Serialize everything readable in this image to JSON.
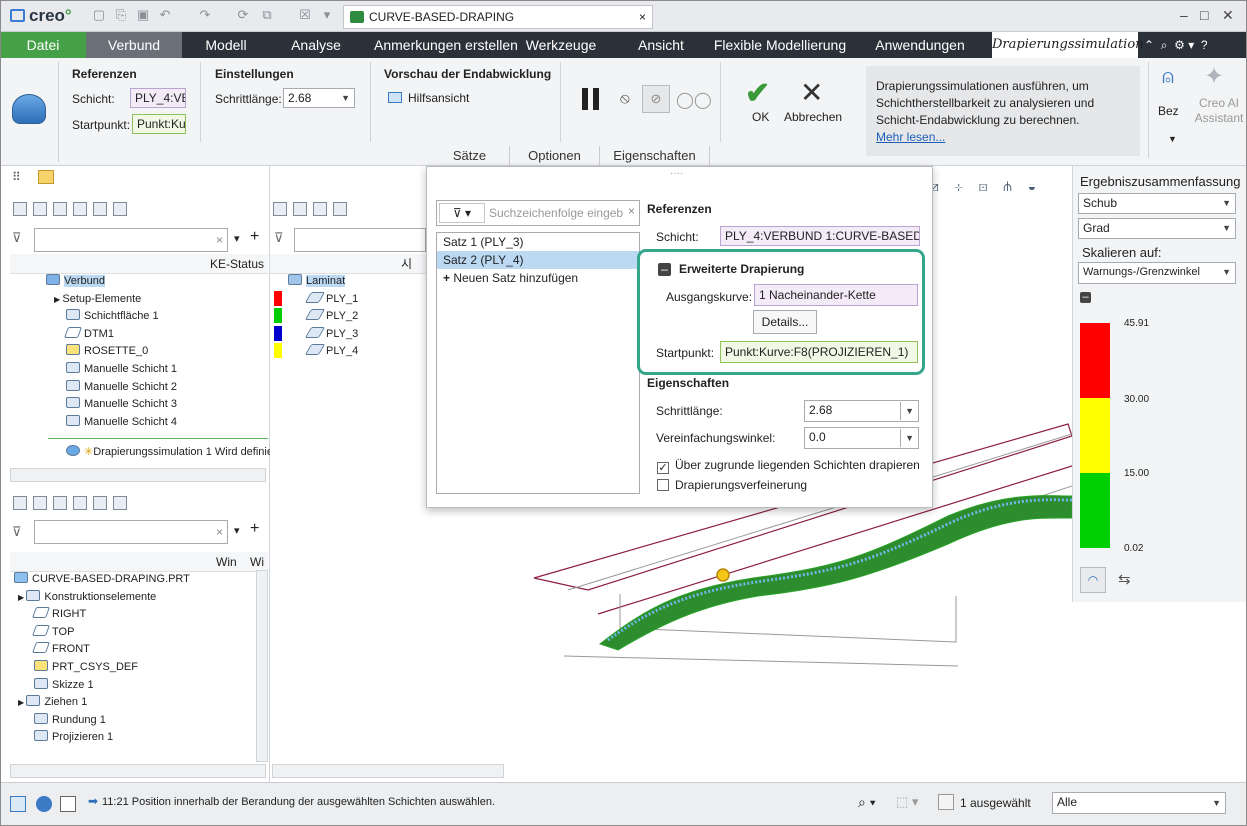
{
  "app": {
    "logo": "creo",
    "doc_tab": "CURVE-BASED-DRAPING"
  },
  "menu": {
    "datei": "Datei",
    "verbund": "Verbund",
    "modell": "Modell",
    "analyse": "Analyse",
    "anmerkungen": "Anmerkungen erstellen",
    "werkzeuge": "Werkzeuge",
    "ansicht": "Ansicht",
    "flexible": "Flexible Modellierung",
    "anwendungen": "Anwendungen",
    "drapierung": "Drapierungssimulation"
  },
  "ribbon": {
    "referenzen_title": "Referenzen",
    "schicht_label": "Schicht:",
    "schicht_value": "PLY_4:VE",
    "startpunkt_label": "Startpunkt:",
    "startpunkt_value": "Punkt:Ku",
    "einstellungen_title": "Einstellungen",
    "schrittlaenge_label": "Schrittlänge:",
    "schrittlaenge_value": "2.68",
    "vorschau_title": "Vorschau der Endabwicklung",
    "hilfsansicht": "Hilfsansicht",
    "ok": "OK",
    "abbrechen": "Abbrechen",
    "help_text": "Drapierungssimulationen ausführen, um Schichtherstellbarkeit zu analysieren und Schicht-Endabwicklung zu berechnen.",
    "mehr_lesen": "Mehr lesen...",
    "bez": "Bez",
    "assistant": "Creo AI Assistant",
    "tabs": [
      "Sätze",
      "Optionen",
      "Eigenschaften"
    ]
  },
  "left_tree": {
    "ke_status": "KE-Status",
    "items": [
      "Verbund",
      "Setup-Elemente",
      "Schichtfläche 1",
      "DTM1",
      "ROSETTE_0",
      "Manuelle Schicht 1",
      "Manuelle Schicht 2",
      "Manuelle Schicht 3",
      "Manuelle Schicht 4",
      "Drapierungssimulation 1",
      "Wird definie"
    ]
  },
  "layer_tree": {
    "header_col": "시",
    "root": "Laminat",
    "plies": [
      {
        "name": "PLY_1",
        "color": "#ff0000"
      },
      {
        "name": "PLY_2",
        "color": "#00cc00"
      },
      {
        "name": "PLY_3",
        "color": "#0000cc"
      },
      {
        "name": "PLY_4",
        "color": "#ffff00"
      }
    ]
  },
  "model_tree": {
    "col1": "Win",
    "col2": "Wi",
    "items": [
      "CURVE-BASED-DRAPING.PRT",
      "Konstruktionselemente",
      "RIGHT",
      "TOP",
      "FRONT",
      "PRT_CSYS_DEF",
      "Skizze 1",
      "Ziehen 1",
      "Rundung 1",
      "Projizieren 1"
    ]
  },
  "popup": {
    "search_placeholder": "Suchzeichenfolge eingeb",
    "sets": [
      "Satz 1 (PLY_3)",
      "Satz 2 (PLY_4)"
    ],
    "add_set": "Neuen Satz hinzufügen",
    "referenzen": "Referenzen",
    "schicht_label": "Schicht:",
    "schicht_value": "PLY_4:VERBUND 1:CURVE-BASED-DR",
    "erweiterte": "Erweiterte Drapierung",
    "ausgangskurve_label": "Ausgangskurve:",
    "ausgangskurve_value": "1 Nacheinander-Kette",
    "details": "Details...",
    "startpunkt_label": "Startpunkt:",
    "startpunkt_value": "Punkt:Kurve:F8(PROJIZIEREN_1)",
    "eigenschaften": "Eigenschaften",
    "schrittlaenge_label": "Schrittlänge:",
    "schrittlaenge_value": "2.68",
    "vereinfachung_label": "Vereinfachungswinkel:",
    "vereinfachung_value": "0.0",
    "cb1": "Über zugrunde liegenden Schichten drapieren",
    "cb2": "Drapierungsverfeinerung"
  },
  "results": {
    "title": "Ergebniszusammenfassung",
    "type_value": "Schub",
    "unit_value": "Grad",
    "scale_label": "Skalieren auf:",
    "scale_value": "Warnungs-/Grenzwinkel",
    "ticks": [
      "45.91",
      "30.00",
      "15.00",
      "0.02"
    ],
    "colors": {
      "red": "#ff0000",
      "yellow": "#ffff00",
      "green": "#00d000"
    }
  },
  "status": {
    "message": "11:21 Position innerhalb der Berandung der ausgewählten Schichten auswählen.",
    "selected": "1 ausgewählt",
    "filter": "Alle"
  }
}
